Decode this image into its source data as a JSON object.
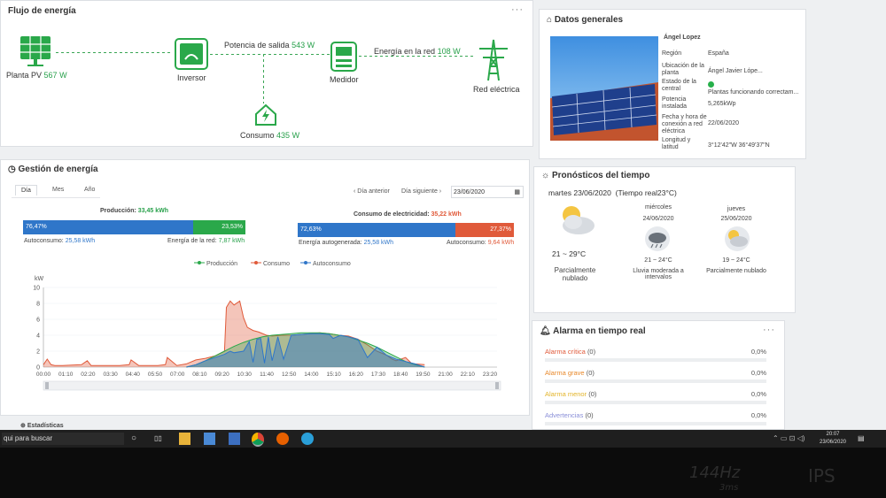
{
  "flow": {
    "title": "Flujo de energía",
    "pv_label": "Planta PV",
    "pv_value": "567 W",
    "inverter_label": "Inversor",
    "output_label": "Potencia de salida",
    "output_value": "543 W",
    "meter_label": "Medidor",
    "grid_flow_label": "Energía en la red",
    "grid_flow_value": "108 W",
    "grid_label": "Red eléctrica",
    "consumption_label": "Consumo",
    "consumption_value": "435 W",
    "menu": "···"
  },
  "general": {
    "title": "Datos generales",
    "owner": "Ángel Lopez",
    "rows": [
      {
        "label": "Región",
        "value": "España"
      },
      {
        "label": "Ubicación de la planta",
        "value": "Ángel Javier Lópe..."
      },
      {
        "label": "Estado de la central",
        "value": "Plantas funcionando correctam..."
      },
      {
        "label": "Potencia instalada",
        "value": "5,265kWp"
      },
      {
        "label": "Fecha y hora de conexión a red eléctrica",
        "value": "22/06/2020"
      },
      {
        "label": "Longitud y latitud",
        "value": "3°12'42\"W 36°49'37\"N"
      }
    ],
    "status_color": "#27b04a"
  },
  "energy": {
    "title": "Gestión de energía",
    "tabs": [
      "Día",
      "Mes",
      "Año"
    ],
    "prev_day": "‹ Día anterior",
    "next_day": "Día siguiente ›",
    "date": "23/06/2020",
    "production_title": "Producción:",
    "production_value": "33,45 kWh",
    "prod_bar_left": "76,47%",
    "prod_bar_right": "23,53%",
    "autoconsumo_label": "Autoconsumo:",
    "autoconsumo_value": "25,58 kWh",
    "grid_energy_label": "Energía de la red:",
    "grid_energy_value": "7,87 kWh",
    "consumption_title": "Consumo de electricidad:",
    "consumption_value": "35,22 kWh",
    "cons_bar_left": "72,63%",
    "cons_bar_right": "27,37%",
    "self_gen_label": "Energía autogenerada:",
    "self_gen_value": "25,58 kWh",
    "autoconsumo2_label": "Autoconsumo:",
    "autoconsumo2_value": "9,64 kWh",
    "stats_label": "Estadísticas"
  },
  "chart_data": {
    "type": "area",
    "ylabel": "kW",
    "ylim": [
      0,
      10
    ],
    "yticks": [
      0,
      2,
      4,
      6,
      8,
      10
    ],
    "x_labels": [
      "00:00",
      "01:10",
      "02:20",
      "03:30",
      "04:40",
      "05:50",
      "07:00",
      "08:10",
      "09:20",
      "10:30",
      "11:40",
      "12:50",
      "14:00",
      "15:10",
      "16:20",
      "17:30",
      "18:40",
      "19:50",
      "21:00",
      "22:10",
      "23:20"
    ],
    "x_hours": [
      0,
      1,
      2,
      3,
      4,
      5,
      6,
      7,
      8,
      9,
      10,
      11,
      12,
      13,
      14,
      15,
      16,
      17,
      18,
      19,
      20,
      21,
      22,
      23
    ],
    "legend": [
      "Producción",
      "Consumo",
      "Autoconsumo"
    ],
    "colors": {
      "production": "#2aa84a",
      "consumption": "#e05a3a",
      "autoconsumo": "#2f76c9"
    },
    "series": [
      {
        "name": "Producción",
        "x": [
          7.5,
          8,
          8.5,
          9,
          9.5,
          10,
          10.5,
          11,
          11.5,
          12,
          12.5,
          13,
          13.5,
          14,
          14.5,
          15,
          15.5,
          16,
          16.5,
          17,
          17.5,
          18,
          18.5,
          19,
          19.5,
          20
        ],
        "y": [
          0,
          0.3,
          0.8,
          1.4,
          2.0,
          2.6,
          3.1,
          3.5,
          3.8,
          4.0,
          4.1,
          4.2,
          4.3,
          4.3,
          4.3,
          4.2,
          4.0,
          3.8,
          3.4,
          3.0,
          2.5,
          1.9,
          1.3,
          0.7,
          0.3,
          0
        ]
      },
      {
        "name": "Consumo",
        "x": [
          0,
          0.2,
          0.4,
          0.6,
          1,
          2,
          2.3,
          2.5,
          3,
          4,
          4.5,
          4.6,
          5,
          6,
          6.4,
          6.5,
          7,
          7.5,
          8,
          8.5,
          9,
          9.5,
          9.6,
          9.8,
          10,
          10.3,
          10.5,
          10.7,
          11,
          11.3,
          11.7,
          12,
          12.5,
          13,
          13.5,
          14,
          14.5,
          15,
          15.5,
          16,
          16.5,
          17,
          17.5,
          18,
          18.3,
          18.5,
          19,
          19.3,
          19.5,
          20
        ],
        "y": [
          0.3,
          1.0,
          0.3,
          0.2,
          0.2,
          0.3,
          0.8,
          0.2,
          0.2,
          0.2,
          0.3,
          0.9,
          0.2,
          0.2,
          0.3,
          1.2,
          0.2,
          0.4,
          0.9,
          1.1,
          1.4,
          2.0,
          7.5,
          8.3,
          7.8,
          8.3,
          6.2,
          5.0,
          4.6,
          4.4,
          4.0,
          3.9,
          4.0,
          4.0,
          4.1,
          4.2,
          4.3,
          4.2,
          4.0,
          3.9,
          3.5,
          2.8,
          2.0,
          1.5,
          1.0,
          0.8,
          1.2,
          0.5,
          0.4,
          0.3
        ]
      },
      {
        "name": "Autoconsumo",
        "x": [
          7.5,
          8,
          8.5,
          9,
          9.5,
          9.8,
          10,
          10.5,
          10.8,
          11,
          11.2,
          11.4,
          11.6,
          11.8,
          12,
          12.3,
          12.6,
          13,
          13.5,
          14,
          14.5,
          15,
          15.2,
          15.6,
          16,
          16.5,
          17,
          17.5,
          18,
          18.5,
          19,
          19.5,
          20
        ],
        "y": [
          0,
          0.3,
          0.8,
          1.2,
          1.6,
          2.0,
          1.8,
          2.0,
          3.2,
          0.6,
          3.5,
          3.6,
          0.5,
          3.8,
          0.8,
          3.8,
          1.0,
          4.0,
          4.1,
          4.2,
          4.2,
          4.1,
          3.6,
          4.0,
          3.8,
          3.5,
          1.2,
          2.5,
          1.5,
          1.0,
          0.7,
          0.4,
          0
        ]
      }
    ]
  },
  "weather": {
    "title": "Pronósticos del tiempo",
    "today": "martes 23/06/2020",
    "realtime": "(Tiempo real23°C)",
    "today_range": "21 ~ 29°C",
    "today_desc": "Parcialmente nublado",
    "days": [
      {
        "name": "miércoles",
        "date": "24/06/2020",
        "range": "21 ~ 24°C",
        "desc": "Lluvia moderada a intervalos"
      },
      {
        "name": "jueves",
        "date": "25/06/2020",
        "range": "19 ~ 24°C",
        "desc": "Parcialmente nublado"
      }
    ]
  },
  "alarms": {
    "title": "Alarma en tiempo real",
    "menu": "···",
    "rows": [
      {
        "label": "Alarma crítica",
        "count": "(0)",
        "pct": "0,0%",
        "color": "#e05a3a"
      },
      {
        "label": "Alarma grave",
        "count": "(0)",
        "pct": "0,0%",
        "color": "#e8882a"
      },
      {
        "label": "Alarma menor",
        "count": "(0)",
        "pct": "0,0%",
        "color": "#e3b42a"
      },
      {
        "label": "Advertencias",
        "count": "(0)",
        "pct": "0,0%",
        "color": "#8a8fd8"
      }
    ]
  },
  "taskbar": {
    "search": "qui para buscar",
    "time": "20:07",
    "date": "23/06/2020"
  },
  "bezel": {
    "hz": "144Hz",
    "ms": "3ms",
    "ips": "IPS"
  }
}
